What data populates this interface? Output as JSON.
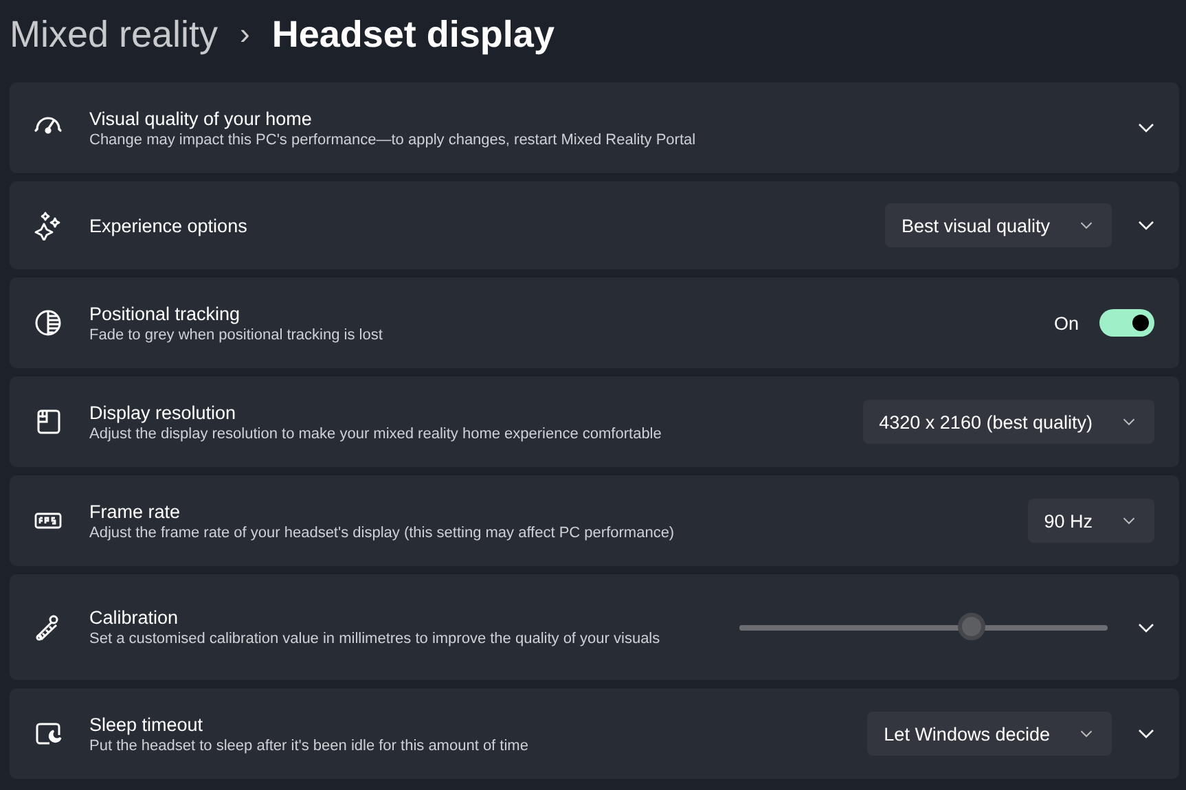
{
  "breadcrumb": {
    "parent": "Mixed reality",
    "separator": "›",
    "current": "Headset display"
  },
  "settings": [
    {
      "title": "Visual quality of your home",
      "description": "Change may impact this PC's performance—to apply changes, restart Mixed Reality Portal",
      "kind": "none",
      "expandable": true
    },
    {
      "title": "Experience options",
      "kind": "dropdown",
      "value": "Best visual quality",
      "expandable": true
    },
    {
      "title": "Positional tracking",
      "description": "Fade to grey when positional tracking is lost",
      "kind": "toggle",
      "state_label": "On",
      "on": true,
      "expandable": false
    },
    {
      "title": "Display resolution",
      "description": "Adjust the display resolution to make your mixed reality home experience comfortable",
      "kind": "dropdown",
      "value": "4320 x 2160 (best quality)",
      "expandable": false
    },
    {
      "title": "Frame rate",
      "description": "Adjust the frame rate of your headset's display (this setting may affect PC performance)",
      "kind": "dropdown",
      "value": "90 Hz",
      "expandable": false
    },
    {
      "title": "Calibration",
      "description": "Set a customised calibration value in millimetres to improve the quality of your visuals",
      "kind": "slider",
      "level": 0.63,
      "disabled": true,
      "expandable": true
    },
    {
      "title": "Sleep timeout",
      "description": "Put the headset to sleep after it's been idle for this amount of time",
      "kind": "dropdown",
      "value": "Let Windows decide",
      "expandable": true
    }
  ]
}
